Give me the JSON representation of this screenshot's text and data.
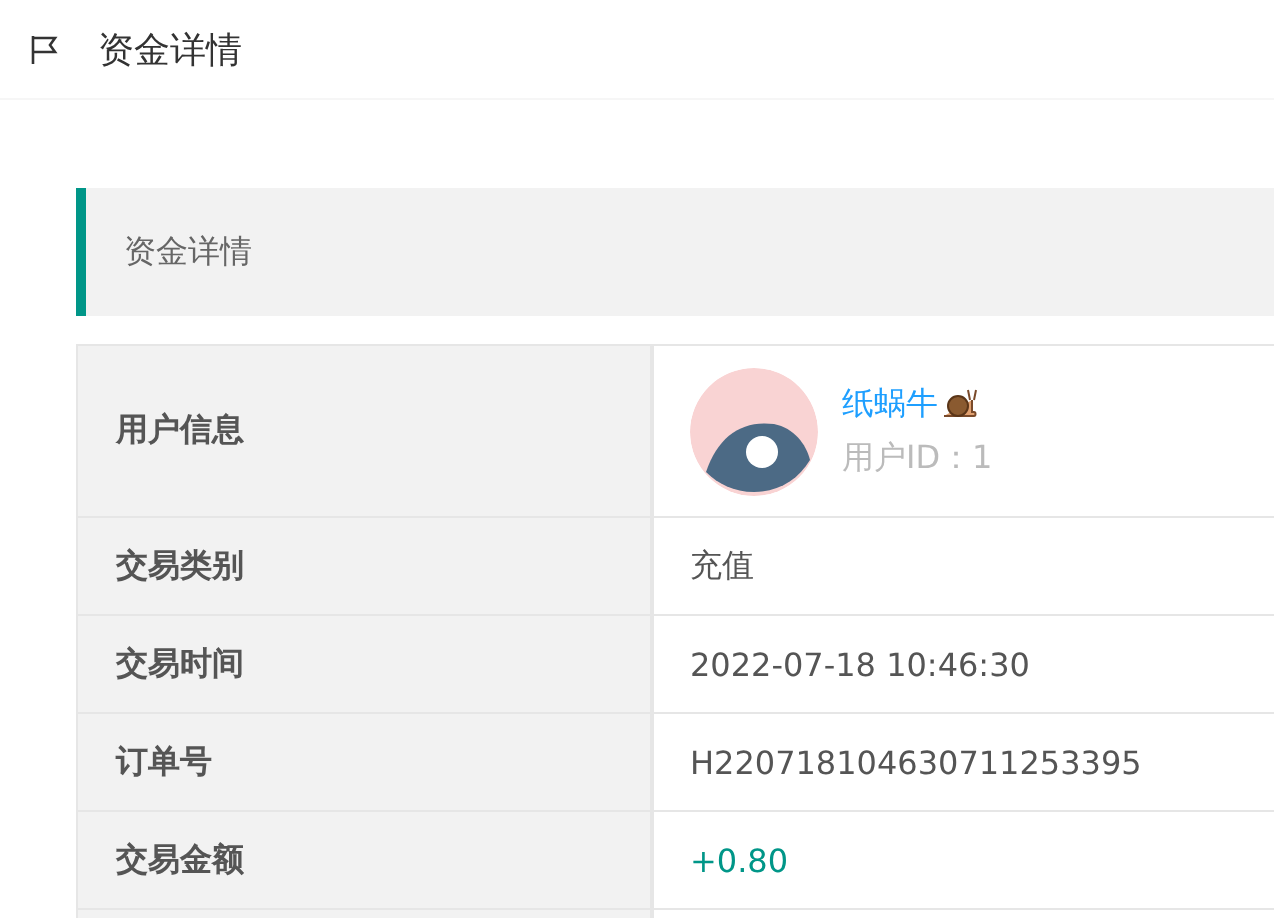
{
  "header": {
    "title": "资金详情"
  },
  "section": {
    "title": "资金详情"
  },
  "rows": [
    {
      "kind": "user",
      "label": "用户信息",
      "name": "纸蜗牛",
      "user_id": "用户ID：1"
    },
    {
      "kind": "text",
      "label": "交易类别",
      "value": "充值"
    },
    {
      "kind": "text",
      "label": "交易时间",
      "value": "2022-07-18 10:46:30"
    },
    {
      "kind": "text",
      "label": "订单号",
      "value": "H220718104630711253395"
    },
    {
      "kind": "amount",
      "label": "交易金额",
      "value": "+0.80"
    }
  ]
}
